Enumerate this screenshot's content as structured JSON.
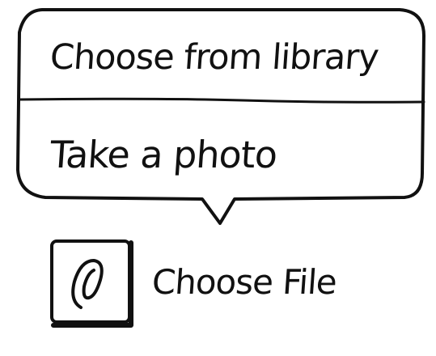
{
  "popover": {
    "items": [
      {
        "label": "Choose from library"
      },
      {
        "label": "Take a photo"
      }
    ]
  },
  "file_picker": {
    "icon": "paperclip-icon",
    "label": "Choose File"
  }
}
